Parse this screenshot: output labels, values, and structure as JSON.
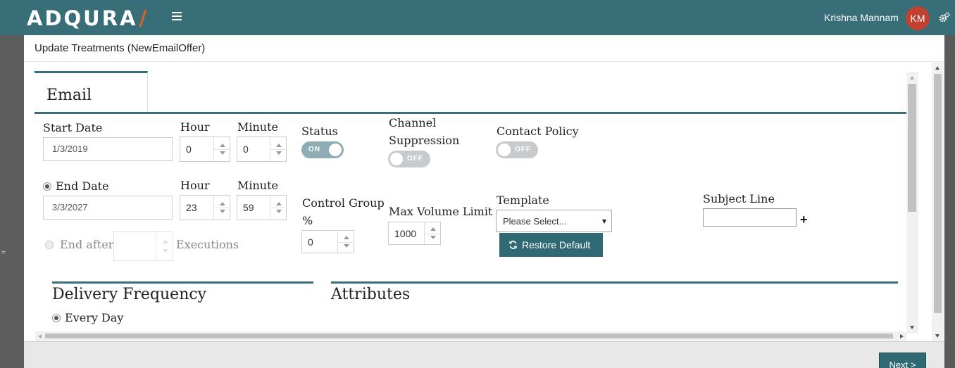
{
  "app": {
    "logo": "ADQURA",
    "logo_slash": "/",
    "user_name": "Krishna Mannam",
    "user_initials": "KM",
    "accent_color": "#376e78",
    "logo_slash_color": "#e0602a",
    "avatar_color": "#c2402f"
  },
  "modal": {
    "title": "Update Treatments (NewEmailOffer)",
    "tab_label": "Email",
    "next_label": "Next >"
  },
  "form": {
    "start_date_label": "Start Date",
    "start_date_value": "1/3/2019",
    "start_hour_label": "Hour",
    "start_hour_value": "0",
    "start_minute_label": "Minute",
    "start_minute_value": "0",
    "status_label": "Status",
    "status_toggle": "ON",
    "channel_suppression_label_1": "Channel",
    "channel_suppression_label_2": "Suppression",
    "channel_suppression_toggle": "OFF",
    "contact_policy_label": "Contact Policy",
    "contact_policy_toggle": "OFF",
    "end_date_label": "End Date",
    "end_date_value": "3/3/2027",
    "end_hour_label": "Hour",
    "end_hour_value": "23",
    "end_minute_label": "Minute",
    "end_minute_value": "59",
    "control_group_label_1": "Control Group",
    "control_group_label_2": "%",
    "control_group_value": "0",
    "max_volume_label": "Max Volume Limit",
    "max_volume_value": "1000",
    "template_label": "Template",
    "template_selected": "Please Select...",
    "restore_default_label": "Restore Default",
    "subject_line_label": "Subject Line",
    "subject_line_value": "",
    "end_after_label": "End after",
    "end_after_value": "",
    "executions_label": "Executions"
  },
  "sections": {
    "delivery_frequency_title": "Delivery Frequency",
    "every_day_label": "Every Day",
    "attributes_title": "Attributes"
  }
}
